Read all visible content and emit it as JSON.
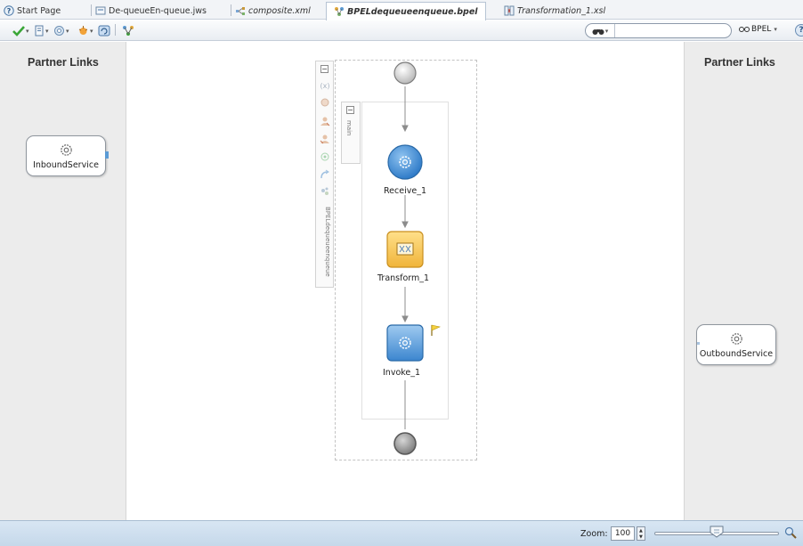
{
  "tabs": [
    {
      "label": "Start Page",
      "icon": "help-circle-icon"
    },
    {
      "label": "De-queueEn-queue.jws",
      "icon": "project-icon"
    },
    {
      "label": "composite.xml",
      "icon": "composite-icon"
    },
    {
      "label": "BPELdequeueenqueue.bpel",
      "icon": "bpel-icon",
      "active": true
    },
    {
      "label": "Transformation_1.xsl",
      "icon": "xsl-map-icon"
    }
  ],
  "toolbar": {
    "icons": [
      "validate-check-icon",
      "bookmark-icon",
      "settings-icon",
      "debug-icon",
      "refresh-icon",
      "deploy-icon"
    ],
    "search_value": "",
    "search_icon": "binoculars-icon",
    "bpel_menu_label": "BPEL",
    "help_icon": "help-icon"
  },
  "left_panel": {
    "title": "Partner Links",
    "service_label": "InboundService"
  },
  "right_panel": {
    "title": "Partner Links",
    "service_label": "OutboundService"
  },
  "canvas": {
    "process_label": "BPELdequeueenqueue",
    "sequence_label": "main",
    "activities": [
      {
        "label": "Receive_1",
        "type": "receive",
        "icon": "receive-gear-icon"
      },
      {
        "label": "Transform_1",
        "type": "transform",
        "icon": "transform-icon"
      },
      {
        "label": "Invoke_1",
        "type": "invoke",
        "icon": "invoke-gear-icon",
        "flag": "yellow-flag-icon"
      }
    ],
    "side_tools": [
      "variables-icon",
      "correlation-icon",
      "partner-role-icon",
      "partner-role-alt-icon",
      "fault-handler-icon",
      "event-handler-icon",
      "compensation-icon"
    ]
  },
  "statusbar": {
    "zoom_label": "Zoom:",
    "zoom_value": "100",
    "zoom_level": 0.5
  },
  "colors": {
    "accent_blue": "#5b9bd5",
    "transform_yellow": "#f7c948",
    "status_bar": "#c9dcee"
  }
}
